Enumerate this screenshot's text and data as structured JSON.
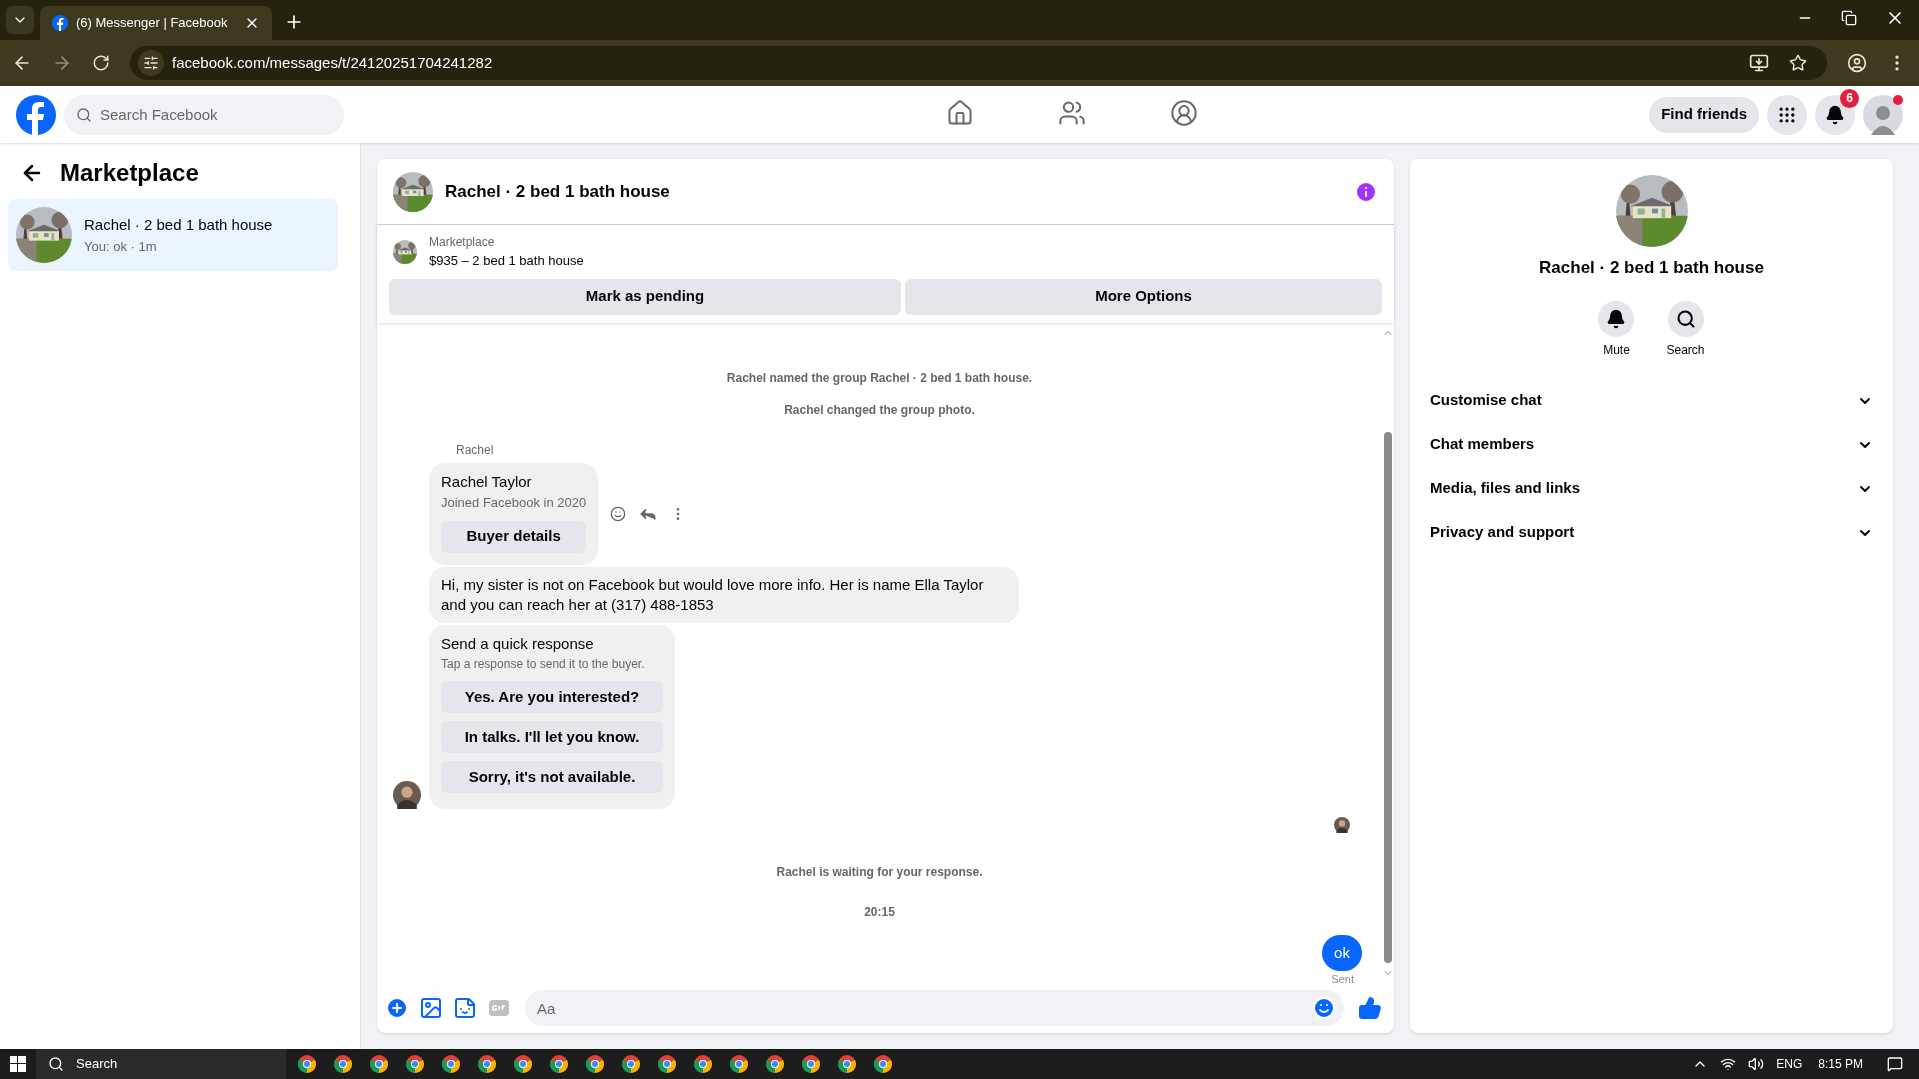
{
  "browser": {
    "tab": {
      "title": "(6) Messenger | Facebook",
      "selected": true
    },
    "url": "facebook.com/messages/t/24120251704241282"
  },
  "header": {
    "search": {
      "placeholder": "Search Facebook"
    },
    "nav": [
      {
        "kind": "home",
        "selected": false
      },
      {
        "kind": "friends",
        "selected": false
      },
      {
        "kind": "groups",
        "selected": false
      }
    ],
    "find_friends": "Find friends",
    "notifications": "6"
  },
  "sidebar": {
    "title": "Marketplace",
    "items": [
      {
        "name": "Rachel · 2 bed 1 bath house",
        "preview": "You: ok · 1m",
        "selected": true
      }
    ]
  },
  "chat": {
    "title": "Rachel · 2 bed 1 bath house",
    "listing": {
      "label": "Marketplace",
      "title": "$935 – 2 bed 1 bath house"
    },
    "actions": [
      "Mark as pending",
      "More Options"
    ],
    "events": [
      "Rachel named the group Rachel · 2 bed 1 bath house.",
      "Rachel changed the group photo."
    ],
    "sender": "Rachel",
    "buyer_card": {
      "name": "Rachel Taylor",
      "joined": "Joined Facebook in 2020",
      "button": "Buyer details"
    },
    "message": "Hi, my sister is not on Facebook but would love more info. Her is name Ella Taylor and you can reach her at (317) 488-1853",
    "quick": {
      "title": "Send a quick response",
      "hint": "Tap a response to send it to the buyer.",
      "options": [
        "Yes. Are you interested?",
        "In talks. I'll let you know.",
        "Sorry, it's not available."
      ]
    },
    "waiting": "Rachel is waiting for your response.",
    "time": "20:15",
    "my_message": "ok",
    "status": "Sent",
    "composer": {
      "placeholder": "Aa"
    }
  },
  "details": {
    "title": "Rachel · 2 bed 1 bath house",
    "actions": [
      {
        "kind": "mute",
        "label": "Mute"
      },
      {
        "kind": "search",
        "label": "Search"
      }
    ],
    "sections": [
      {
        "label": "Customise chat",
        "expanded": false
      },
      {
        "label": "Chat members",
        "expanded": false
      },
      {
        "label": "Media, files and links",
        "expanded": false
      },
      {
        "label": "Privacy and support",
        "expanded": false
      }
    ]
  },
  "taskbar": {
    "search": "Search",
    "language": "ENG",
    "clock": "8:15 PM"
  }
}
